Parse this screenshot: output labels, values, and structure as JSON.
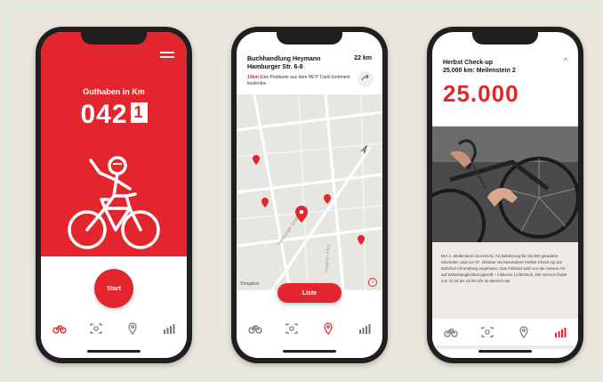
{
  "colors": {
    "brand_red": "#e3262e",
    "dark": "#1f1f1f",
    "background": "#e9e6de"
  },
  "phone1": {
    "balance_label": "Guthaben in Km",
    "counter_main": "042",
    "counter_last": "1",
    "start_label": "Start",
    "tabs": [
      {
        "icon": "bike-icon",
        "active": true
      },
      {
        "icon": "scan-icon",
        "active": false
      },
      {
        "icon": "location-pin-icon",
        "active": false
      },
      {
        "icon": "stats-icon",
        "active": false
      }
    ]
  },
  "phone2": {
    "shop_name": "Buchhandlung Heymann",
    "shop_address": "Hamburger Str. 6-8",
    "distance": "22 km",
    "notice_highlight": "10km",
    "notice_text": "Eine Postkarte aus dem HEY! Card-Sortiment kostenlos",
    "map_logo": "©mapbox",
    "map_street_1": "Hamburger Straße",
    "map_street_2": "Hagener Allee",
    "list_label": "Liste",
    "tabs": [
      {
        "icon": "bike-icon",
        "active": false
      },
      {
        "icon": "scan-icon",
        "active": false
      },
      {
        "icon": "location-pin-icon",
        "active": true
      },
      {
        "icon": "stats-icon",
        "active": false
      }
    ]
  },
  "phone3": {
    "title": "Herbst Check-up",
    "subtitle": "25.000 km: Meilenstein 2",
    "big_number": "25.000",
    "body": "Der 2. Meilenstein ist erreicht. Als Belohnung für 25.000 geradelte Kilometer, wird vor 07. Oktober ein besonderer Herbst Check-Up am Bahnhof Ahrensburg angeboten. Das Fahrrad wird von der Gewos AG auf Wintertauglichkeit geprüft – inklusive Lichtcheck. Der Service findet von 11:00 bis 18:30 Uhr im Bereich der",
    "tabs": [
      {
        "icon": "bike-icon",
        "active": false
      },
      {
        "icon": "scan-icon",
        "active": false
      },
      {
        "icon": "location-pin-icon",
        "active": false
      },
      {
        "icon": "stats-icon",
        "active": true
      }
    ]
  }
}
